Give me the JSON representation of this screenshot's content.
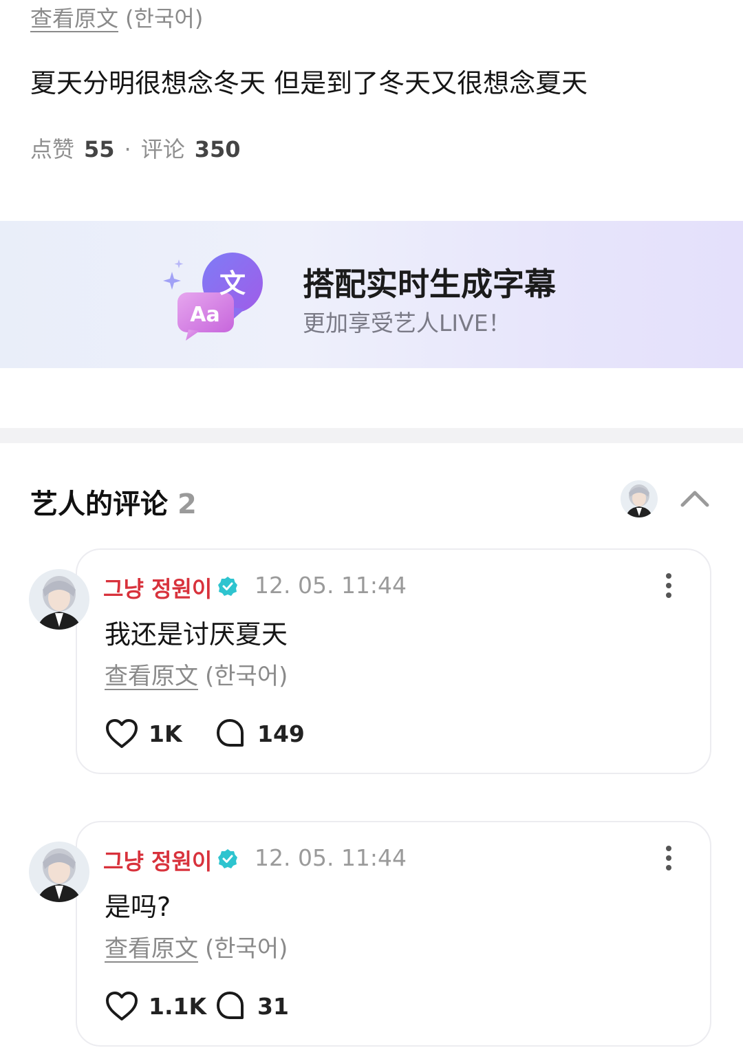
{
  "post": {
    "view_original": "查看原文",
    "original_lang": "(한국어)",
    "text": "夏天分明很想念冬天 但是到了冬天又很想念夏天",
    "likes_label": "点赞",
    "likes": "55",
    "separator": "·",
    "comments_label": "评论",
    "comments": "350"
  },
  "banner": {
    "icon_label_front": "Aa",
    "icon_label_back": "文",
    "title": "搭配实时生成字幕",
    "subtitle": "更加享受艺人LIVE！"
  },
  "artist_comments": {
    "title": "艺人的评论",
    "count": "2",
    "items": [
      {
        "author": "그냥 정원이",
        "time": "12. 05. 11:44",
        "text": "我还是讨厌夏天",
        "view_original": "查看原文",
        "original_lang": "(한국어)",
        "likes": "1K",
        "replies": "149"
      },
      {
        "author": "그냥 정원이",
        "time": "12. 05. 11:44",
        "text": "是吗?",
        "view_original": "查看原文",
        "original_lang": "(한국어)",
        "likes": "1.1K",
        "replies": "31"
      }
    ]
  },
  "colors": {
    "author_name": "#d8323c",
    "verified_badge": "#2ec4cf",
    "muted_text": "#8a8a8a",
    "banner_bg": "#e9ecfa",
    "bubble_purple": "#8b63f0",
    "bubble_pink": "#d47be0"
  },
  "icons": {
    "banner": "translate-bubble-icon",
    "verified": "verified-badge-icon",
    "more": "more-vertical-icon",
    "like": "heart-icon",
    "reply": "comment-bubble-icon",
    "collapse": "chevron-up-icon"
  }
}
